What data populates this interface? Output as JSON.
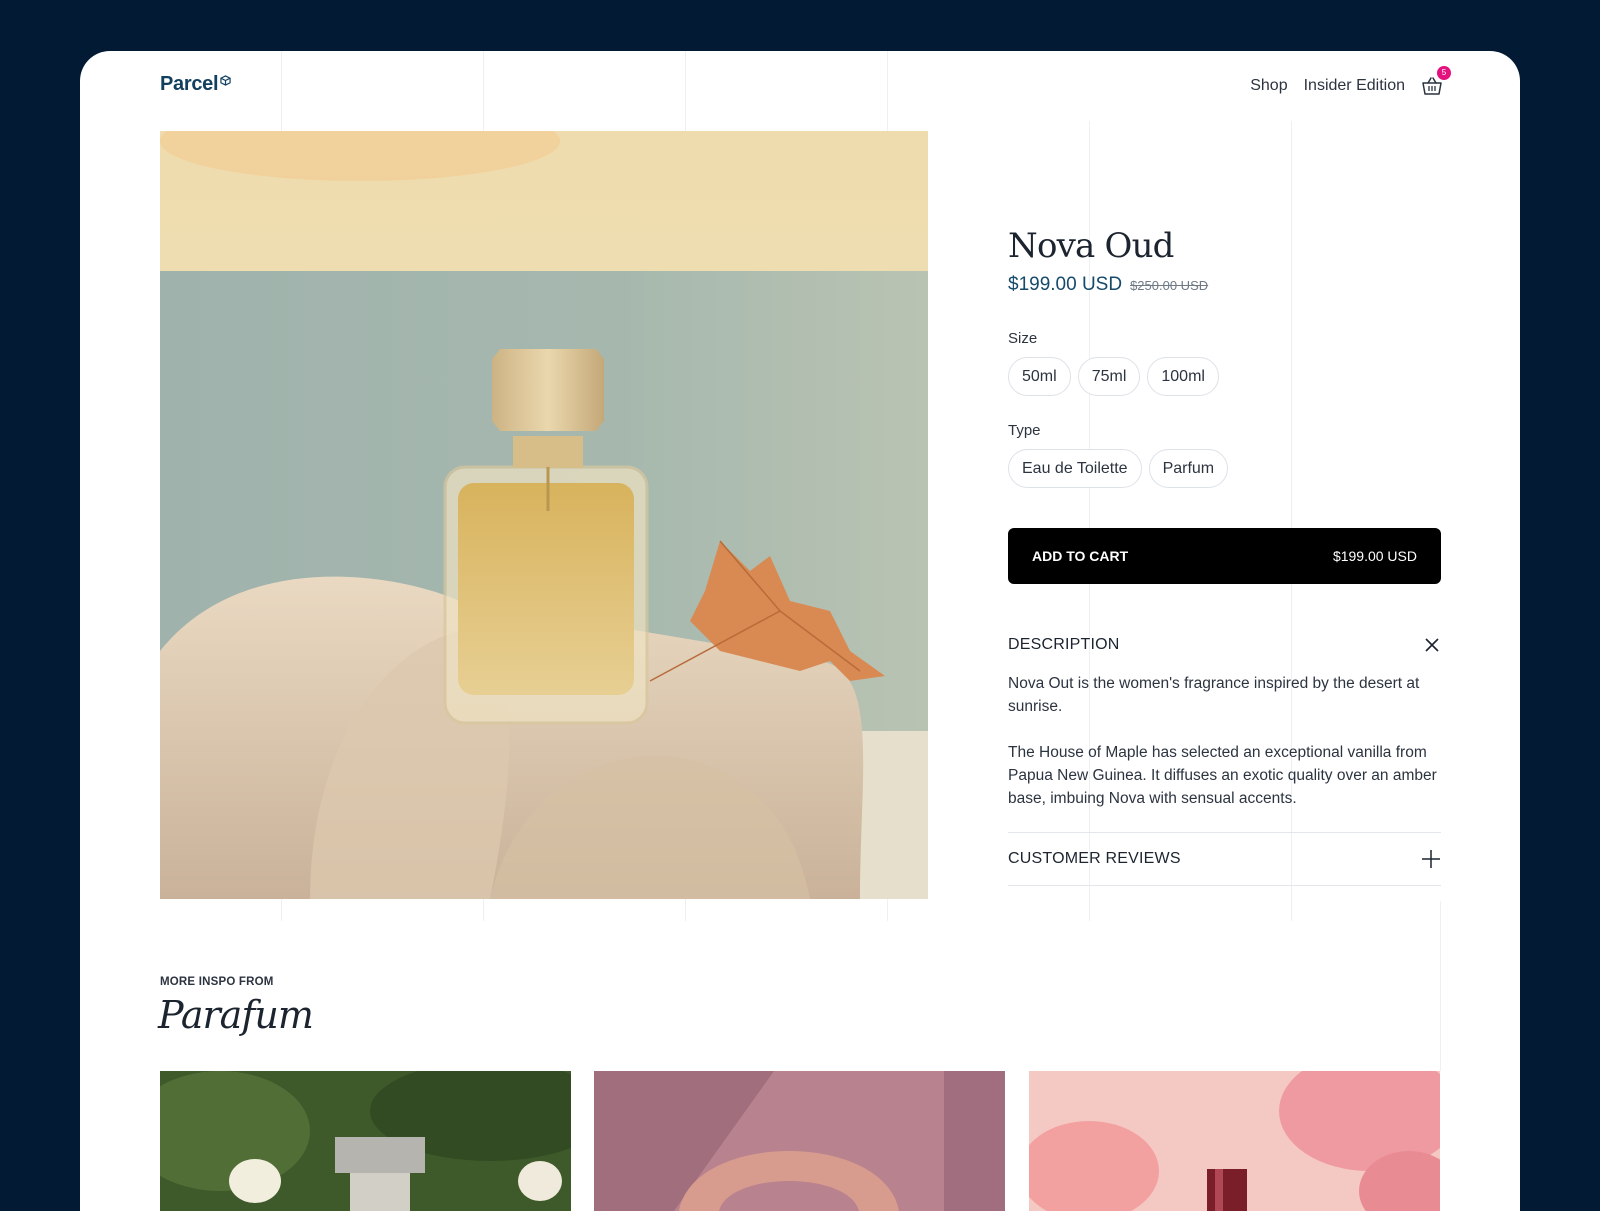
{
  "header": {
    "logo": "Parcel",
    "nav": [
      "Shop",
      "Insider Edition"
    ],
    "cart_count": "5"
  },
  "product": {
    "title": "Nova Oud",
    "price": "$199.00 USD",
    "old_price": "$250.00 USD",
    "size_label": "Size",
    "sizes": [
      "50ml",
      "75ml",
      "100ml"
    ],
    "type_label": "Type",
    "types": [
      "Eau de Toilette",
      "Parfum"
    ],
    "add_to_cart": "ADD TO CART",
    "add_to_cart_price": "$199.00 USD"
  },
  "description": {
    "heading": "DESCRIPTION",
    "paragraphs": [
      "Nova Out is the women's fragrance inspired by the desert at sunrise.",
      "The House of Maple has selected an exceptional vanilla from Papua New Guinea. It diffuses an exotic quality over an amber base, imbuing Nova with sensual accents."
    ]
  },
  "reviews": {
    "heading": "CUSTOMER REVIEWS"
  },
  "more": {
    "label": "MORE INSPO FROM",
    "title": "Parafum"
  },
  "icons": {
    "logo": "cube-icon",
    "cart": "basket-icon",
    "close": "close-icon",
    "expand": "plus-icon"
  },
  "colors": {
    "background": "#021a33",
    "brand": "#123f5f",
    "price": "#164a6b",
    "badge": "#e3127f",
    "button": "#000000"
  }
}
